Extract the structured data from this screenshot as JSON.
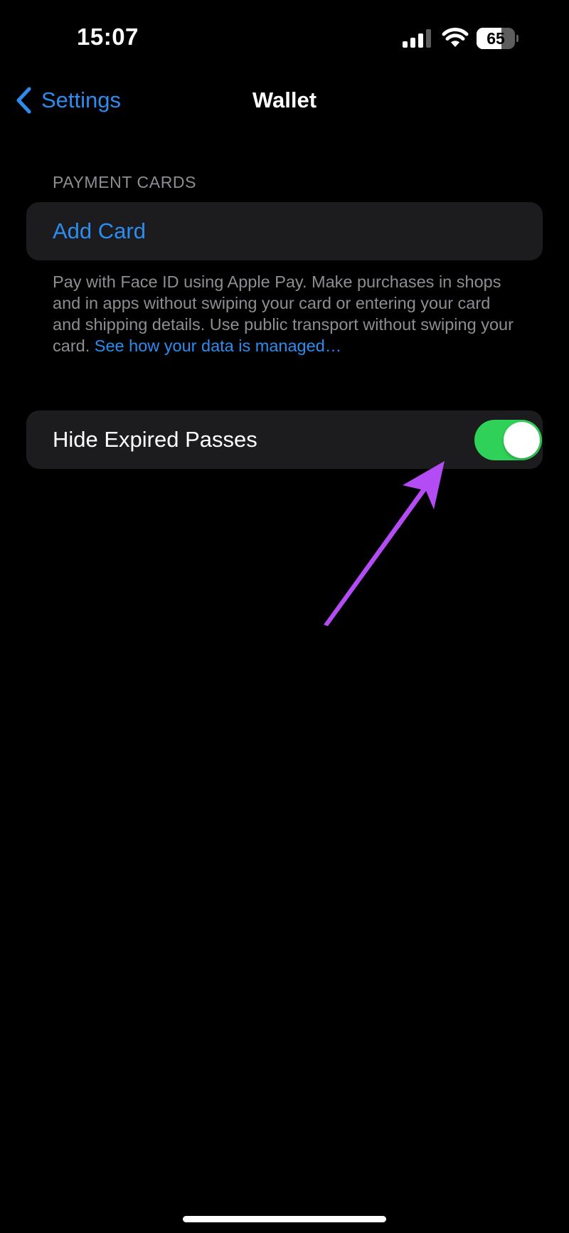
{
  "status_bar": {
    "time": "15:07",
    "battery_level": "65",
    "battery_fraction": 0.65,
    "icons": [
      "signal-icon",
      "wifi-icon",
      "battery-icon"
    ]
  },
  "nav": {
    "back_label": "Settings",
    "title": "Wallet"
  },
  "payment_cards": {
    "header": "PAYMENT CARDS",
    "add_card_label": "Add Card",
    "footer_text": "Pay with Face ID using Apple Pay. Make purchases in shops and in apps without swiping your card or entering your card and shipping details. Use public transport without swiping your card.",
    "footer_link": "See how your data is managed…"
  },
  "hide_expired": {
    "label": "Hide Expired Passes",
    "on": true
  },
  "colors": {
    "accent_blue": "#2d8cf0",
    "toggle_on": "#30d158",
    "cell_background": "#1c1c1e",
    "secondary_text": "#8d8d93",
    "annotation_arrow": "#b44cf5"
  }
}
